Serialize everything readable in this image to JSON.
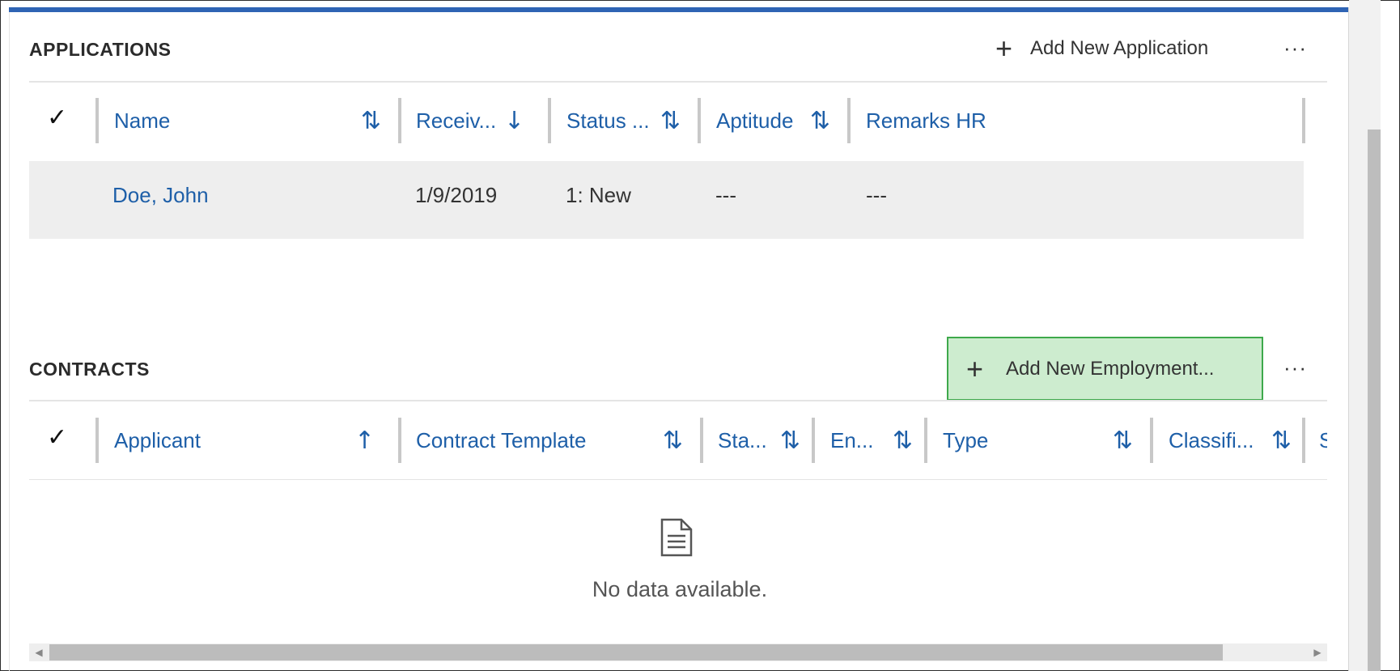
{
  "applications": {
    "title": "APPLICATIONS",
    "add_label": "Add New Application",
    "more_label": "···",
    "select_all_glyph": "✓",
    "columns": [
      {
        "label": "Name",
        "sort_glyph": "⇅"
      },
      {
        "label": "Receiv...",
        "sort_glyph": "↓"
      },
      {
        "label": "Status ...",
        "sort_glyph": "⇅"
      },
      {
        "label": "Aptitude",
        "sort_glyph": "⇅"
      },
      {
        "label": "Remarks HR",
        "sort_glyph": ""
      }
    ],
    "rows": [
      {
        "name": "Doe, John",
        "received": "1/9/2019",
        "status": "1: New",
        "aptitude": "---",
        "remarks": "---"
      }
    ]
  },
  "contracts": {
    "title": "CONTRACTS",
    "add_label": "Add New Employment...",
    "more_label": "···",
    "select_all_glyph": "✓",
    "columns": [
      {
        "label": "Applicant",
        "sort_glyph": "↑"
      },
      {
        "label": "Contract Template",
        "sort_glyph": "⇅"
      },
      {
        "label": "Sta...",
        "sort_glyph": "⇅"
      },
      {
        "label": "En...",
        "sort_glyph": "⇅"
      },
      {
        "label": "Type",
        "sort_glyph": "⇅"
      },
      {
        "label": "Classifi...",
        "sort_glyph": "⇅"
      },
      {
        "label": "S",
        "sort_glyph": ""
      }
    ],
    "empty_text": "No data available."
  },
  "colors": {
    "accent": "#2f64b4",
    "link": "#1e5fa8",
    "highlight_fill": "#cdeccf",
    "highlight_border": "#3ea94b"
  },
  "icons": {
    "add": "plus-icon",
    "more": "more-icon",
    "empty": "document-icon"
  }
}
